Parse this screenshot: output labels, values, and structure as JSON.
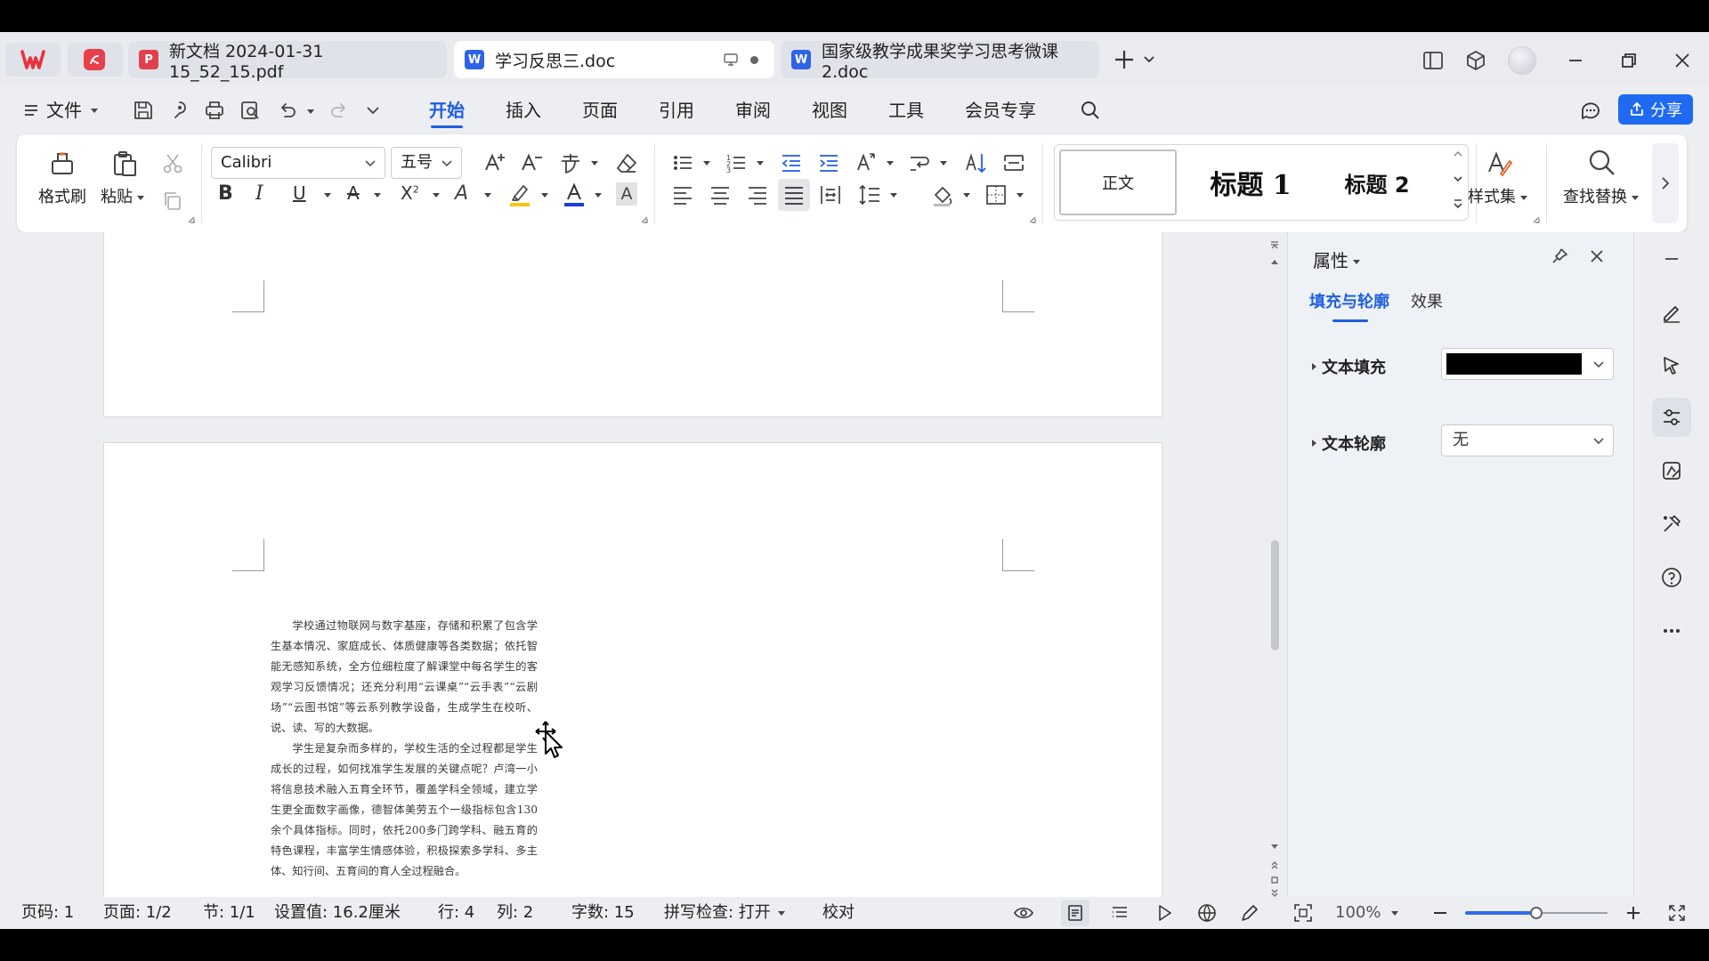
{
  "tabs": [
    {
      "title": "新文档 2024-01-31 15_52_15.pdf",
      "icon": "pdf-icon",
      "color": "#e0404e"
    },
    {
      "title": "学习反思三.doc",
      "icon": "word-icon",
      "color": "#2f63e6"
    },
    {
      "title": "国家级教学成果奖学习思考微课2.doc",
      "icon": "word-icon",
      "color": "#2f63e6"
    }
  ],
  "menu": {
    "file": "文件",
    "items": [
      "开始",
      "插入",
      "页面",
      "引用",
      "审阅",
      "视图",
      "工具",
      "会员专享"
    ],
    "share": "分享"
  },
  "ribbon": {
    "format_painter": "格式刷",
    "paste": "粘贴",
    "font_name": "Calibri",
    "font_size": "五号",
    "styles": [
      "正文",
      "标题 1",
      "标题 2"
    ],
    "style_set": "样式集",
    "find_replace": "查找替换"
  },
  "document": {
    "paragraphs": [
      "学校通过物联网与数字基座，存储和积累了包含学生基本情况、家庭成长、体质健康等各类数据；依托智能无感知系统，全方位细粒度了解课堂中每名学生的客观学习反馈情况；还充分利用“云课桌”“云手表”“云剧场”“云图书馆”等云系列教学设备，生成学生在校听、说、读、写的大数据。",
      "学生是复杂而多样的，学校生活的全过程都是学生成长的过程，如何找准学生发展的关键点呢？卢湾一小将信息技术融入五育全环节，覆盖学科全领域，建立学生更全面数字画像，德智体美劳五个一级指标包含130余个具体指标。同时，依托200多门跨学科、融五育的特色课程，丰富学生情感体验，积极探索多学科、多主体、知行间、五育间的育人全过程融合。"
    ]
  },
  "properties": {
    "title": "属性",
    "tabs": [
      "填充与轮廓",
      "效果"
    ],
    "text_fill_label": "文本填充",
    "text_fill_color": "#000000",
    "text_outline_label": "文本轮廓",
    "text_outline_value": "无"
  },
  "status": {
    "page_num": "页码: 1",
    "page": "页面: 1/2",
    "section": "节: 1/1",
    "setting": "设置值: 16.2厘米",
    "row": "行: 4",
    "col": "列: 2",
    "words": "字数: 15",
    "spell": "拼写检查: 打开",
    "proof": "校对",
    "zoom": "100%",
    "zoom_fraction": 0.5
  }
}
